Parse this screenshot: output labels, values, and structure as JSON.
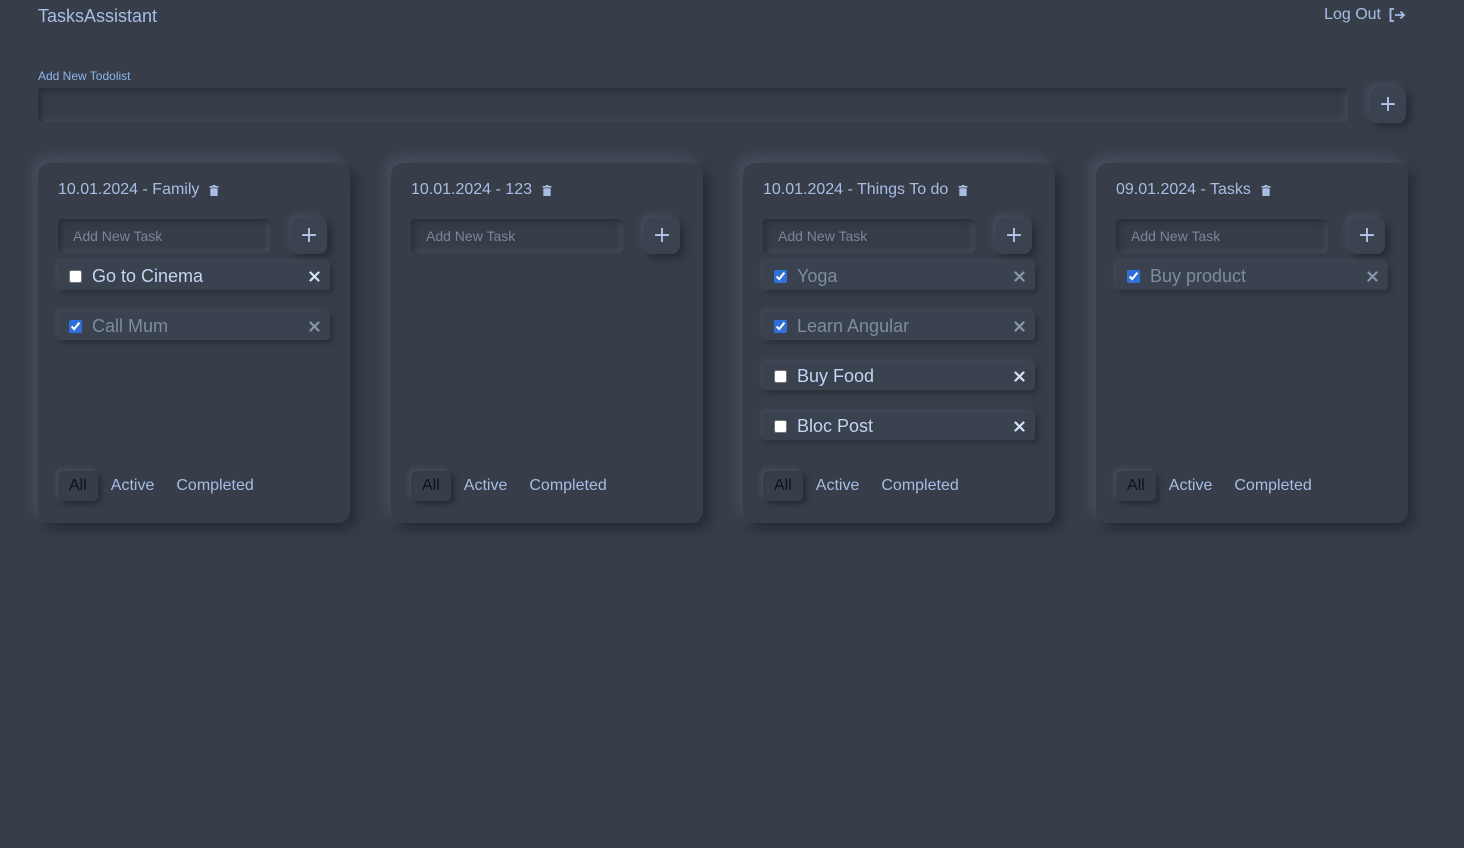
{
  "header": {
    "app_title": "TasksAssistant",
    "logout_label": "Log Out",
    "logout_icon": "logout-icon"
  },
  "new_todolist": {
    "label": "Add New Todolist",
    "value": "",
    "add_icon": "plus-icon"
  },
  "task_placeholder": "Add New Task",
  "filters": {
    "all": "All",
    "active": "Active",
    "completed": "Completed"
  },
  "selected_filter": "all",
  "colors": {
    "background": "#373e4a",
    "accent_text": "#a7bde4",
    "checkbox": "#2f6fd8"
  },
  "todolists": [
    {
      "title": "10.01.2024 - Family",
      "tasks": [
        {
          "title": "Go to Cinema",
          "done": false
        },
        {
          "title": "Call Mum",
          "done": true
        }
      ]
    },
    {
      "title": "10.01.2024 - 123",
      "tasks": []
    },
    {
      "title": "10.01.2024 - Things To do",
      "tasks": [
        {
          "title": "Yoga",
          "done": true
        },
        {
          "title": "Learn Angular",
          "done": true
        },
        {
          "title": "Buy Food",
          "done": false
        },
        {
          "title": "Bloc Post",
          "done": false
        }
      ]
    },
    {
      "title": "09.01.2024 - Tasks",
      "tasks": [
        {
          "title": "Buy product",
          "done": true
        }
      ]
    }
  ]
}
